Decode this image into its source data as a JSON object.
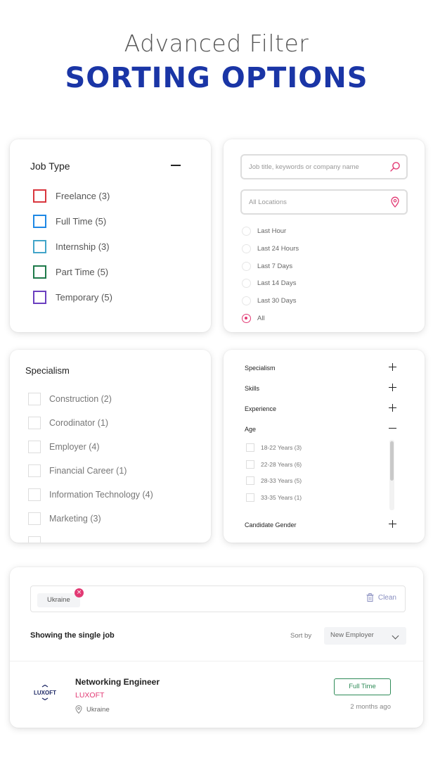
{
  "hero": {
    "line1": "Advanced Filter",
    "line2": "SORTING OPTIONS"
  },
  "job_type": {
    "title": "Job Type",
    "items": [
      {
        "label": "Freelance (3)",
        "color": "#d9363e"
      },
      {
        "label": "Full Time (5)",
        "color": "#1e88e5"
      },
      {
        "label": "Internship (3)",
        "color": "#42a5c9"
      },
      {
        "label": "Part Time (5)",
        "color": "#1e7a4a"
      },
      {
        "label": "Temporary (5)",
        "color": "#6b3fbf"
      }
    ]
  },
  "search": {
    "keyword_placeholder": "Job title, keywords or company name",
    "location_placeholder": "All Locations",
    "date_options": [
      "Last Hour",
      "Last 24 Hours",
      "Last 7 Days",
      "Last 14 Days",
      "Last 30 Days",
      "All"
    ],
    "selected_date": "All"
  },
  "specialism": {
    "title": "Specialism",
    "items": [
      "Construction (2)",
      "Corodinator (1)",
      "Employer (4)",
      "Financial Career (1)",
      "Information Technology (4)",
      "Marketing (3)"
    ]
  },
  "accordion": {
    "sections": [
      "Specialism",
      "Skills",
      "Experience"
    ],
    "age_label": "Age",
    "age_options": [
      "18-22 Years (3)",
      "22-28 Years (6)",
      "28-33 Years (5)",
      "33-35 Years (1)"
    ],
    "gender_label": "Candidate Gender"
  },
  "results": {
    "chip": "Ukraine",
    "clean_label": "Clean",
    "count_text": "Showing the single job",
    "sort_label": "Sort by",
    "sort_value": "New Employer",
    "job": {
      "title": "Networking Engineer",
      "company": "LUXOFT",
      "location": "Ukraine",
      "type": "Full Time",
      "posted": "2 months ago",
      "logo_text": "LUXOFT"
    }
  },
  "colors": {
    "brand_blue": "#1a35a6",
    "accent_pink": "#e23a74",
    "badge_green": "#2e8b57"
  }
}
